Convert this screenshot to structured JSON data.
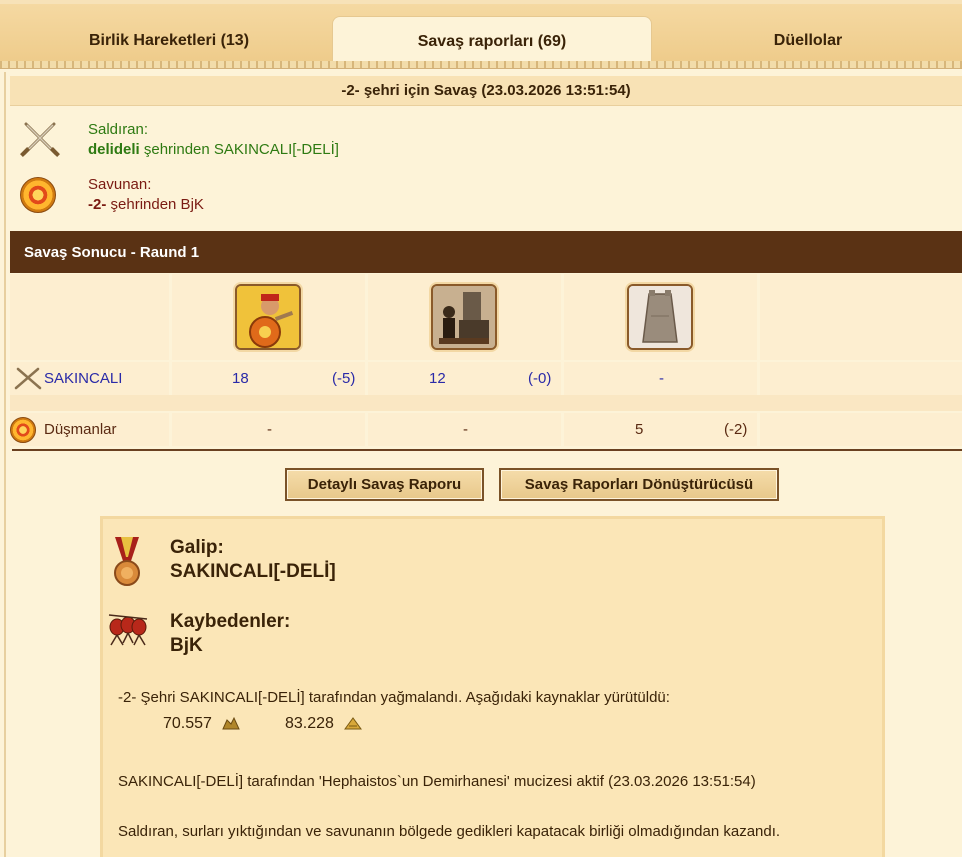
{
  "tabs": [
    {
      "label": "Birlik Hareketleri (13)"
    },
    {
      "label": "Savaş raporları (69)"
    },
    {
      "label": "Düellolar"
    }
  ],
  "battle": {
    "title": "-2- şehri için Savaş (23.03.2026 13:51:54)",
    "attacker_label": "Saldıran:",
    "attacker_city": "delideli",
    "attacker_rest": " şehrinden SAKINCALI[-DELİ]",
    "defender_label": "Savunan:",
    "defender_city": "-2-",
    "defender_rest": " şehrinden BjK"
  },
  "result_bar": "Savaş Sonucu - Raund 1",
  "units": [
    "hoplite-unit",
    "catapult-unit",
    "wall-unit"
  ],
  "rows": {
    "ally": {
      "label": "SAKINCALI",
      "cells": [
        {
          "count": "18",
          "loss": "(-5)"
        },
        {
          "count": "12",
          "loss": "(-0)"
        },
        {
          "count": "-",
          "loss": ""
        }
      ]
    },
    "enemy": {
      "label": "Düşmanlar",
      "cells": [
        {
          "count": "-",
          "loss": ""
        },
        {
          "count": "-",
          "loss": ""
        },
        {
          "count": "5",
          "loss": "(-2)"
        }
      ]
    }
  },
  "buttons": {
    "detail": "Detaylı Savaş Raporu",
    "converter": "Savaş Raporları Dönüştürücüsü"
  },
  "summary": {
    "winner_label": "Galip:",
    "winner": "SAKINCALI[-DELİ]",
    "losers_label": "Kaybedenler:",
    "losers": "BjK",
    "plunder_text": "-2- Şehri SAKINCALI[-DELİ] tarafından yağmalandı. Aşağıdaki kaynaklar yürütüldü:",
    "resource1": "70.557",
    "resource2": "83.228",
    "miracle_text": "SAKINCALI[-DELİ] tarafından 'Hephaistos`un Demirhanesi' mucizesi aktif (23.03.2026 13:51:54)",
    "reason_text": "Saldıran, surları yıktığından ve savunanın bölgede gedikleri kapatacak birliği olmadığından kazandı."
  }
}
